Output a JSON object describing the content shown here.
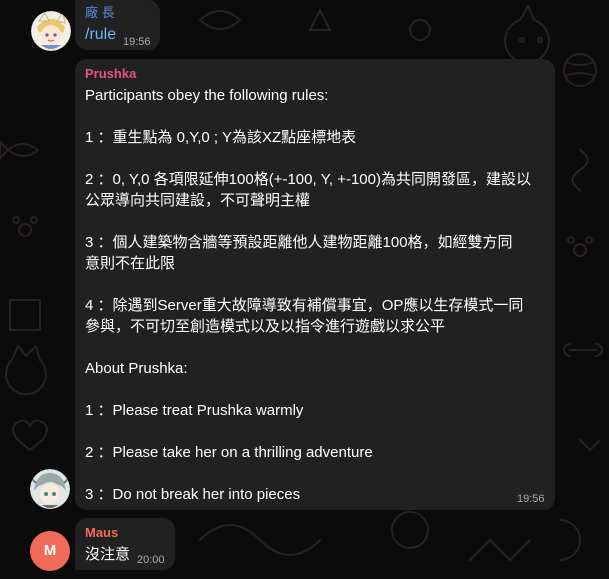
{
  "colors": {
    "background": "#0b0b0c",
    "bubble": "#212121",
    "sender_factory": "#5b8cd6",
    "sender_prushka": "#e8508a",
    "sender_maus": "#f06a5a",
    "link": "#6cb4f5",
    "time": "#aaaaaa"
  },
  "messages": [
    {
      "sender": "廠 長",
      "text": "/rule",
      "time": "19:56"
    },
    {
      "sender": "Prushka",
      "lines": [
        "Participants obey the following rules:",
        "",
        "1 ：重生點為 0,Y,0 ; Y為該XZ點座標地表",
        "",
        "2 ：0, Y,0 各項限延伸100格(+-100, Y, +-100)為共同開發區，建設以",
        "公眾導向共同建設，不可聲明主權",
        "",
        "3 ：個人建築物含牆等預設距離他人建物距離100格，如經雙方同",
        "意則不在此限",
        "",
        "4 ：除遇到Server重大故障導致有補償事宜，OP應以生存模式一同",
        "參與，不可切至創造模式以及以指令進行遊戲以求公平",
        "",
        "About Prushka:",
        "",
        "1 ：Please treat Prushka warmly",
        "",
        "2 ：Please take her on a thrilling adventure",
        "",
        "3 ：Do not break her into pieces"
      ],
      "time": "19:56"
    },
    {
      "sender": "Maus",
      "avatar_letter": "M",
      "text": "沒注意",
      "time": "20:00"
    }
  ]
}
